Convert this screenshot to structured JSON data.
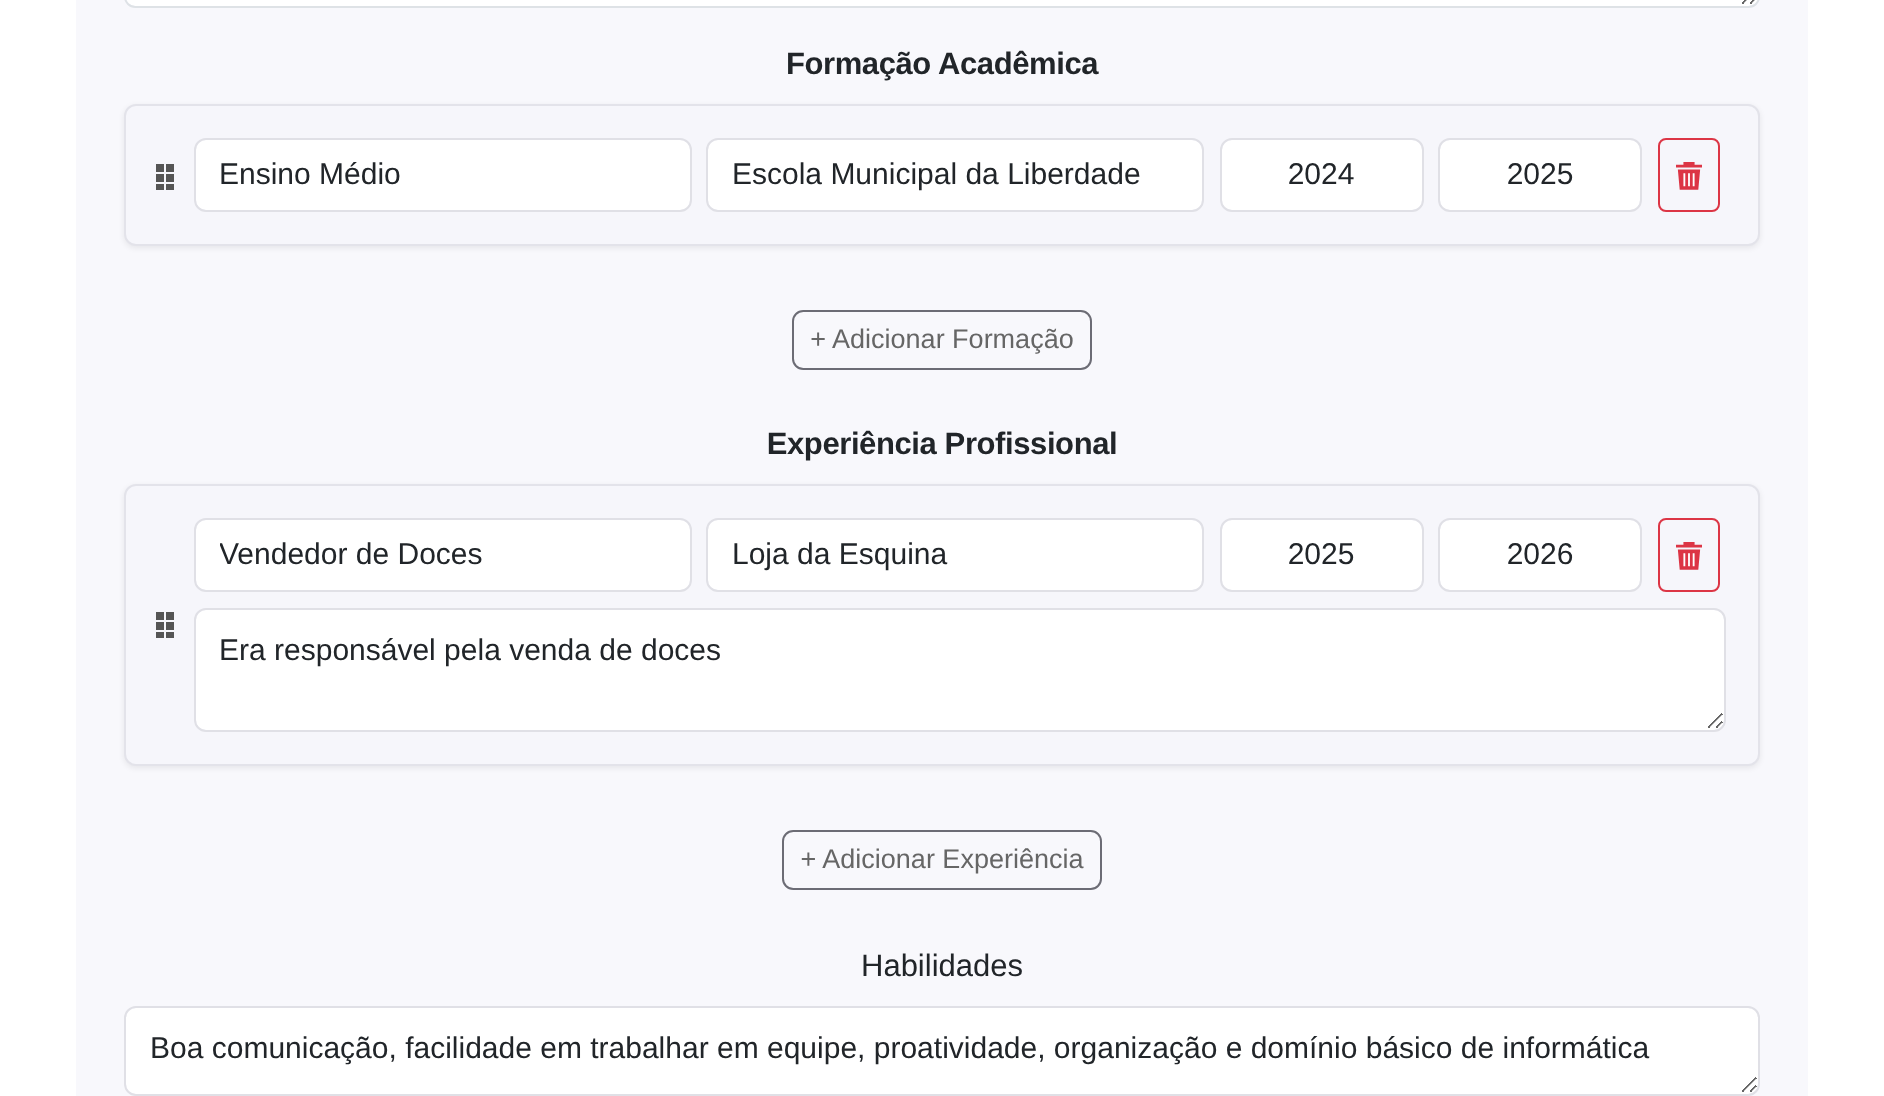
{
  "education": {
    "title": "Formação Acadêmica",
    "entries": [
      {
        "course": "Ensino Médio",
        "institution": "Escola Municipal da Liberdade",
        "start": "2024",
        "end": "2025"
      }
    ],
    "add_button": "+ Adicionar Formação"
  },
  "experience": {
    "title": "Experiência Profissional",
    "entries": [
      {
        "role": "Vendedor de Doces",
        "company": "Loja da Esquina",
        "start": "2025",
        "end": "2026",
        "description": "Era responsável pela venda de doces"
      }
    ],
    "add_button": "+ Adicionar Experiência"
  },
  "skills": {
    "label": "Habilidades",
    "value": "Boa comunicação, facilidade em trabalhar em equipe, proatividade, organização e domínio básico de informática"
  }
}
